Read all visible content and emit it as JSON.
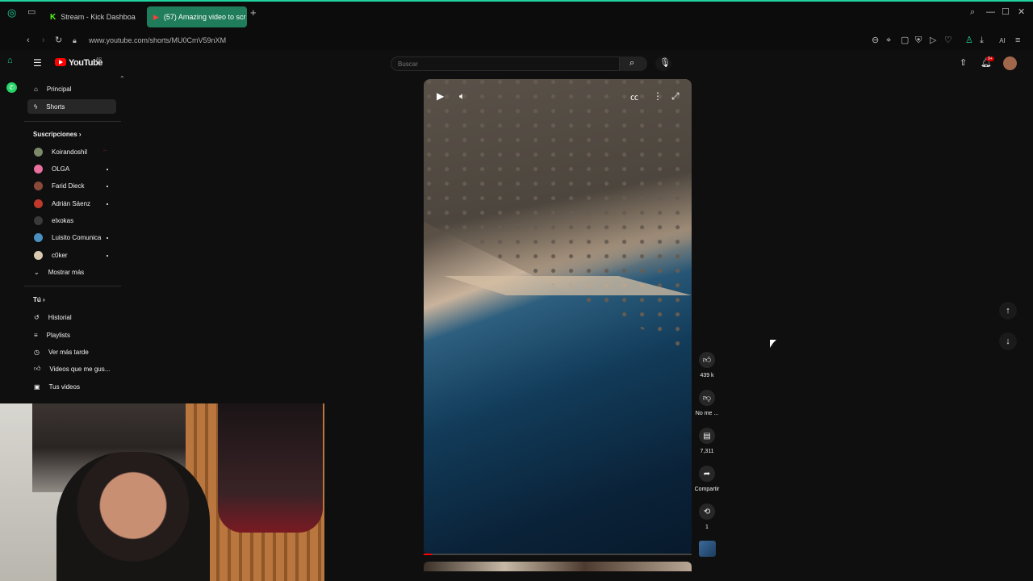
{
  "browser": {
    "tabs": [
      {
        "label": "Stream - Kick Dashboa",
        "active": false
      },
      {
        "label": "(57) Amazing video to scr",
        "active": true
      }
    ],
    "url": "www.youtube.com/shorts/MU0CmV59nXM",
    "toolbar_text": "AI",
    "accent_color": "#1fd3a0"
  },
  "youtube": {
    "logo_text": "YouTube",
    "logo_sup": "AR",
    "search_placeholder": "Buscar",
    "notification_count": "9+",
    "nav": [
      {
        "label": "Principal",
        "icon": "home-icon"
      },
      {
        "label": "Shorts",
        "icon": "shorts-icon",
        "active": true
      }
    ],
    "subscriptions_title": "Suscripciones",
    "subscriptions": [
      {
        "name": "Koirandoshil",
        "color": "#7c8a6a"
      },
      {
        "name": "OLGA",
        "color": "#e86f9e"
      },
      {
        "name": "Farid Dieck",
        "color": "#8a4a3a"
      },
      {
        "name": "Adrián Sáenz",
        "color": "#c0392b"
      },
      {
        "name": "elxokas",
        "color": "#3a3a3a"
      },
      {
        "name": "Luisito Comunica",
        "color": "#4a90c2"
      },
      {
        "name": "c0ker",
        "color": "#d9c9b0"
      }
    ],
    "show_more": "Mostrar más",
    "you_title": "Tú",
    "you_items": [
      {
        "label": "Historial",
        "icon": "history-icon"
      },
      {
        "label": "Playlists",
        "icon": "playlist-icon"
      },
      {
        "label": "Ver más tarde",
        "icon": "clock-icon"
      },
      {
        "label": "Videos que me gus...",
        "icon": "like-icon"
      },
      {
        "label": "Tus videos",
        "icon": "video-icon"
      }
    ],
    "actions": {
      "likes": "439 k",
      "dislike": "No me ...",
      "comments": "7,311",
      "share": "Compartir",
      "remix": "1"
    },
    "progress": 0.03
  }
}
